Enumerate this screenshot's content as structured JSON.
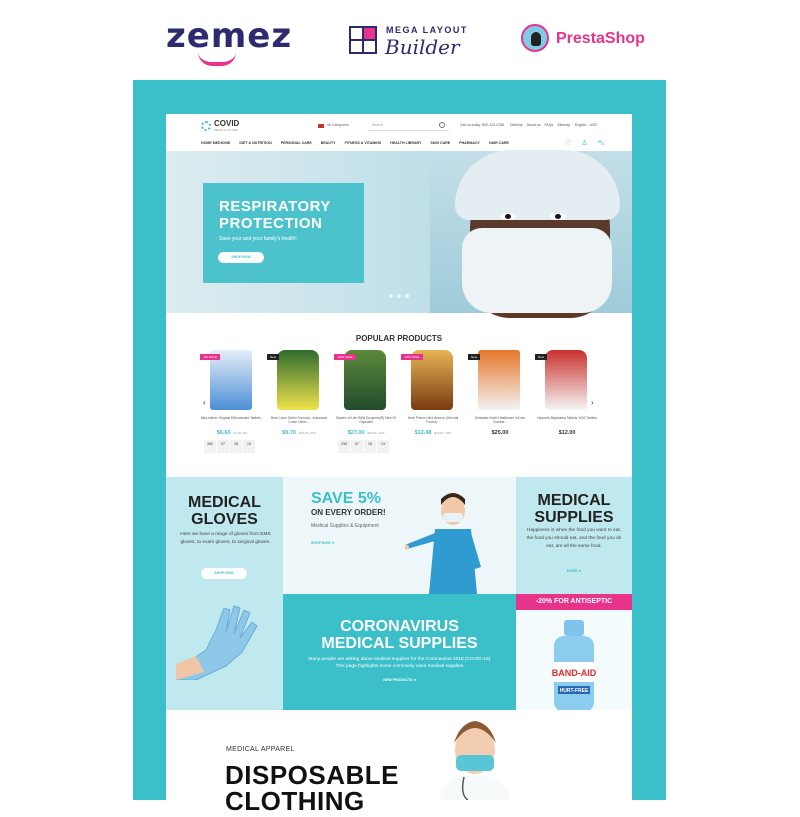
{
  "brands": {
    "zemez": "zemez",
    "mega_top": "MEGA LAYOUT",
    "mega_bottom": "Builder",
    "prestashop": "PrestaShop"
  },
  "header": {
    "store_name": "COVID",
    "store_sub": "MEDICAL STORE",
    "category_select": "All Categories",
    "search_placeholder": "Search",
    "call": "Call us today: 800-123-4785",
    "top_links": [
      "Delivery",
      "About us",
      "FAQs",
      "Sitemap"
    ],
    "language": "English · USD",
    "nav": [
      "HOME MEDICINE",
      "DIET & NUTRITION",
      "PERSONAL CARE",
      "BEAUTY",
      "FITNESS & VITAMINS",
      "HEALTH LIBRARY",
      "SKIN CARE",
      "PHARMACY",
      "HAIR CARE"
    ]
  },
  "hero": {
    "title_line1": "RESPIRATORY",
    "title_line2": "PROTECTION",
    "subtitle": "Save your and your family's health!",
    "button": "SHOP NOW",
    "slide_count": 3
  },
  "popular": {
    "title": "POPULAR PRODUCTS",
    "products": [
      {
        "name": "Alka-seltzer Original Effervescent Tablets...",
        "price": "$6.65",
        "old": "$7.00 -5%",
        "badge": "-5% SALE",
        "badge_type": "sale",
        "sale": true,
        "timer": [
          "260",
          "07",
          "18",
          "13"
        ]
      },
      {
        "name": "Best Colon Detox Formula - Advanced Colon Detox...",
        "price": "$9.70",
        "old": "$10.78 -10%",
        "badge": "New",
        "badge_type": "new",
        "sale": true,
        "timer": []
      },
      {
        "name": "Garden of Life RAW Enzymes(R) Men 90 Capsules",
        "price": "$27.00",
        "old": "$30.00 -10%",
        "badge": "-10% SALE",
        "badge_type": "sale",
        "sale": true,
        "timer": [
          "230",
          "07",
          "18",
          "13"
        ]
      },
      {
        "name": "Herb Pharm Ultra Breeze (Oriental Forest)...",
        "price": "$12.48",
        "old": "$13.87 -10%",
        "badge": "-10% SALE",
        "badge_type": "sale",
        "sale": true,
        "timer": []
      },
      {
        "name": "Schwabe North Healthcare InCare Cumine...",
        "price": "$25.00",
        "old": "",
        "badge": "New",
        "badge_type": "new",
        "sale": false,
        "timer": []
      },
      {
        "name": "Hyland's Bioplasma Tablets 1000 Tablets",
        "price": "$12.00",
        "old": "",
        "badge": "New",
        "badge_type": "new",
        "sale": false,
        "timer": []
      }
    ]
  },
  "banners": {
    "gloves": {
      "title_line1": "MEDICAL",
      "title_line2": "GLOVES",
      "text": "Here we have a range of gloves from EMS gloves, to exam gloves, to surgical gloves.",
      "button": "SHOP NOW"
    },
    "save": {
      "title": "SAVE 5%",
      "subtitle": "ON EVERY ORDER!",
      "text": "Medical Supplies & Equipment",
      "link": "SHOP NOW ➔"
    },
    "supplies": {
      "title_line1": "MEDICAL",
      "title_line2": "SUPPLIES",
      "text": "Happiness is when the food you want to eat, the food you should eat, and the food you do eat, are all the same food.",
      "link": "MORE ➔"
    },
    "corona": {
      "title_line1": "CORONAVIRUS",
      "title_line2": "MEDICAL SUPPLIES",
      "text": "Many people are asking about medical supplies for the Coronavirus 2019 (COVID-19). This page highlights some commonly used medical supplies.",
      "link": "VIEW PRODUCTS ➔"
    },
    "antiseptic": {
      "tag": "-20% FOR ANTISEPTIC",
      "bottle_label": "BAND-AID",
      "bottle_sub": "HURT-FREE"
    }
  },
  "apparel": {
    "label": "MEDICAL APPAREL",
    "title_line1": "DISPOSABLE",
    "title_line2": "CLOTHING"
  },
  "colors": {
    "teal": "#3bbfc8",
    "pink": "#e8338b",
    "navy": "#2e2a6f"
  }
}
